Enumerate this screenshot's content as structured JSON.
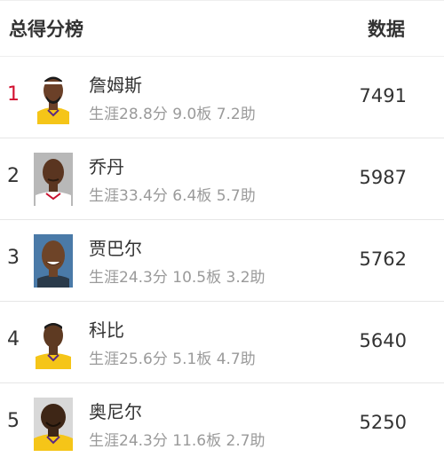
{
  "header": {
    "title": "总得分榜",
    "data_label": "数据"
  },
  "players": [
    {
      "rank": "1",
      "name": "詹姆斯",
      "stats": "生涯28.8分 9.0板 7.2助",
      "value": "7491",
      "avatar": "lebron-james-photo",
      "jersey": "#f5c518"
    },
    {
      "rank": "2",
      "name": "乔丹",
      "stats": "生涯33.4分 6.4板 5.7助",
      "value": "5987",
      "avatar": "michael-jordan-photo",
      "jersey": "#ffffff"
    },
    {
      "rank": "3",
      "name": "贾巴尔",
      "stats": "生涯24.3分 10.5板 3.2助",
      "value": "5762",
      "avatar": "kareem-abdul-jabbar-photo",
      "jersey": "#2a3a4a"
    },
    {
      "rank": "4",
      "name": "科比",
      "stats": "生涯25.6分 5.1板 4.7助",
      "value": "5640",
      "avatar": "kobe-bryant-photo",
      "jersey": "#f5c518"
    },
    {
      "rank": "5",
      "name": "奥尼尔",
      "stats": "生涯24.3分 11.6板 2.7助",
      "value": "5250",
      "avatar": "shaquille-oneal-photo",
      "jersey": "#f5c518"
    }
  ]
}
